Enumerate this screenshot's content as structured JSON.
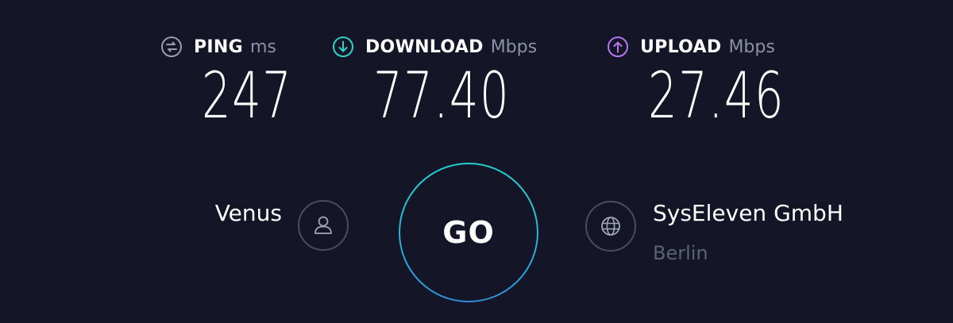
{
  "results": {
    "ping": {
      "title": "PING",
      "unit": "ms",
      "value": "247",
      "icon": "ping-icon"
    },
    "download": {
      "title": "DOWNLOAD",
      "unit": "Mbps",
      "value": "77.40",
      "icon": "download-arrow-icon",
      "color": "#30d2c3"
    },
    "upload": {
      "title": "UPLOAD",
      "unit": "Mbps",
      "value": "27.46",
      "icon": "upload-arrow-icon",
      "color": "#b574f0"
    }
  },
  "isp": {
    "name": "Venus",
    "icon": "user-icon"
  },
  "go_button": {
    "label": "GO"
  },
  "server": {
    "name": "SysEleven GmbH",
    "location": "Berlin",
    "icon": "globe-icon"
  },
  "colors": {
    "background": "#141526",
    "ring_top": "#22d3cc",
    "ring_bottom": "#2d8fd8",
    "muted_text": "#8e90a6"
  }
}
